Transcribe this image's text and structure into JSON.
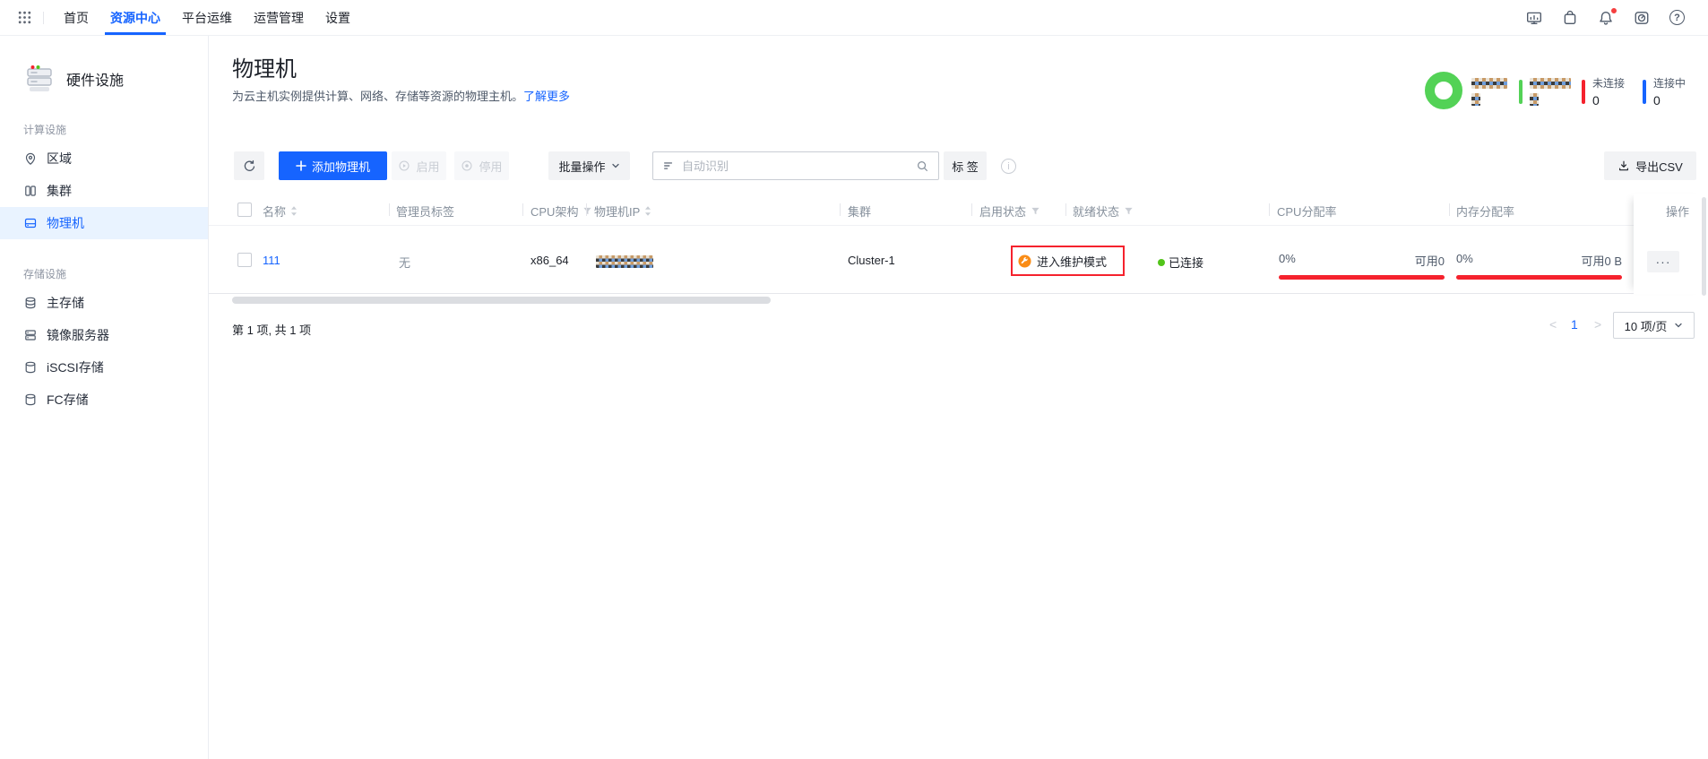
{
  "colors": {
    "primary": "#1664ff",
    "red": "#f5222d",
    "green_donut": "#53d256",
    "green_status": "#52c41a",
    "orange": "#fa8c16"
  },
  "nav": {
    "items": [
      {
        "label": "首页",
        "active": false
      },
      {
        "label": "资源中心",
        "active": true
      },
      {
        "label": "平台运维",
        "active": false
      },
      {
        "label": "运营管理",
        "active": false
      },
      {
        "label": "设置",
        "active": false
      }
    ],
    "right_icons": [
      "monitor-icon",
      "package-icon",
      "bell-icon",
      "gauge-icon",
      "help-icon"
    ],
    "help_glyph": "?",
    "bell_has_badge": true
  },
  "sidebar": {
    "title": "硬件设施",
    "sections": [
      {
        "label": "计算设施",
        "items": [
          {
            "label": "区域",
            "icon": "location-pin-icon",
            "active": false
          },
          {
            "label": "集群",
            "icon": "cluster-icon",
            "active": false
          },
          {
            "label": "物理机",
            "icon": "host-icon",
            "active": true
          }
        ]
      },
      {
        "label": "存储设施",
        "items": [
          {
            "label": "主存储",
            "icon": "database-icon",
            "active": false
          },
          {
            "label": "镜像服务器",
            "icon": "image-server-icon",
            "active": false
          },
          {
            "label": "iSCSI存储",
            "icon": "database-icon",
            "active": false
          },
          {
            "label": "FC存储",
            "icon": "database-icon",
            "active": false
          }
        ]
      }
    ]
  },
  "page": {
    "title": "物理机",
    "subtitle": "为云主机实例提供计算、网络、存储等资源的物理主机。",
    "learn_more": "了解更多"
  },
  "stats": {
    "donut_color": "#53d256",
    "items": [
      {
        "label": "",
        "value": "",
        "censored": true,
        "bar": "none"
      },
      {
        "label": "",
        "value": "",
        "censored": true,
        "bar": "green"
      },
      {
        "label": "未连接",
        "value": "0",
        "censored": false,
        "bar": "red"
      },
      {
        "label": "连接中",
        "value": "0",
        "censored": false,
        "bar": "blue"
      }
    ]
  },
  "toolbar": {
    "add": "添加物理机",
    "enable": "启用",
    "disable": "停用",
    "batch": "批量操作",
    "search_placeholder": "自动识别",
    "tag": "标 签",
    "info_glyph": "i",
    "export": "导出CSV"
  },
  "table": {
    "columns": [
      "名称",
      "管理员标签",
      "CPU架构",
      "物理机IP",
      "集群",
      "启用状态",
      "就绪状态",
      "CPU分配率",
      "内存分配率",
      "操作"
    ],
    "row": {
      "name": "111",
      "admin_tag": "无",
      "cpu_arch": "x86_64",
      "ip_censored": true,
      "cluster": "Cluster-1",
      "enable_status": "进入维护模式",
      "enable_status_highlighted": true,
      "ready_status": "已连接",
      "cpu_percent": "0%",
      "cpu_available": "可用0",
      "mem_percent": "0%",
      "mem_available": "可用0 B",
      "more": "···"
    }
  },
  "footer": {
    "summary": "第 1 项, 共 1 项",
    "prev": "<",
    "page": "1",
    "next": ">",
    "page_size": "10 项/页"
  }
}
